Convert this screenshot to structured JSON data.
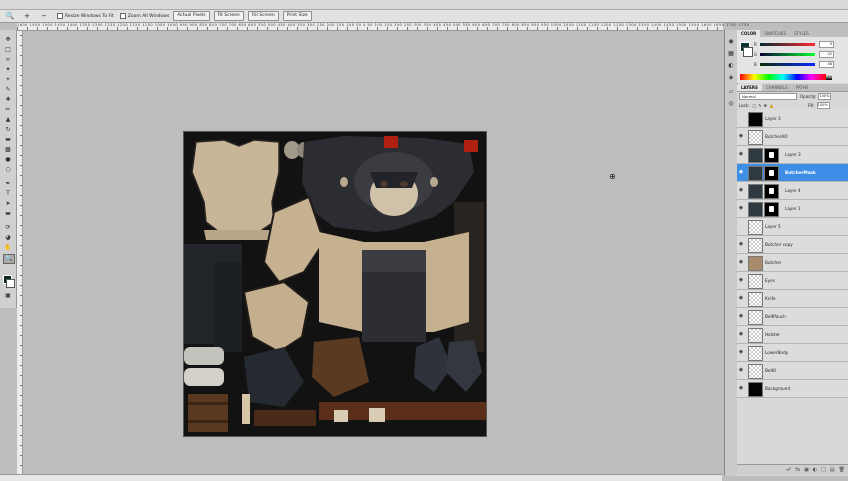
{
  "options_bar": {
    "tool_icon": "zoom-icon",
    "resize_windows": "Resize Windows To Fit",
    "zoom_all_windows": "Zoom All Windows",
    "actual_pixels": "Actual Pixels",
    "fit_screen": "Fit Screen",
    "fill_screen": "Fill Screen",
    "print_size": "Print Size"
  },
  "ruler": {
    "top_labels": "1600 1550 1500 1450 1400 1350 1300 1250 1200 1150 1100 1050 1000 950 900 850 800 750 700 650 600 550 500 450 400 350 300 250 200 150 100 50 0 50 100 150 200 250 300 350 400 450 500 550 600 650 700 750 800 850 900 950 1000 1050 1100 1150 1200 1250 1300 1350 1400 1450 1500 1550 1600 1650 1700 1750"
  },
  "color_panel": {
    "tabs": [
      "COLOR",
      "SWATCHES",
      "STYLES"
    ],
    "active_tab": "COLOR",
    "foreground": "#0d3434",
    "background": "#ffffff",
    "sliders": [
      {
        "label": "R",
        "value": "9"
      },
      {
        "label": "G",
        "value": "42"
      },
      {
        "label": "B",
        "value": "48"
      }
    ]
  },
  "layers_panel": {
    "tabs": [
      "LAYERS",
      "CHANNELS",
      "PATHS"
    ],
    "active_tab": "LAYERS",
    "blend_mode": "Normal",
    "opacity_label": "Opacity:",
    "opacity_value": "100%",
    "lock_label": "Lock:",
    "fill_label": "Fill:",
    "fill_value": "100%",
    "layers": [
      {
        "name": "Layer 3",
        "thumb": "black",
        "mask": false,
        "visible": false,
        "selected": false
      },
      {
        "name": "ButcherAO",
        "thumb": "checker",
        "mask": false,
        "visible": true,
        "selected": false
      },
      {
        "name": "Layer 3",
        "thumb": "tex",
        "mask": true,
        "visible": true,
        "selected": false
      },
      {
        "name": "ButcherMask",
        "thumb": "tex",
        "mask": true,
        "visible": true,
        "selected": true
      },
      {
        "name": "Layer 4",
        "thumb": "tex",
        "mask": true,
        "visible": true,
        "selected": false
      },
      {
        "name": "Layer 1",
        "thumb": "tex",
        "mask": true,
        "visible": true,
        "selected": false
      },
      {
        "name": "Layer 5",
        "thumb": "checker",
        "mask": false,
        "visible": false,
        "selected": false
      },
      {
        "name": "Butcher copy",
        "thumb": "checker",
        "mask": false,
        "visible": true,
        "selected": false
      },
      {
        "name": "Butcher",
        "thumb": "tan",
        "mask": false,
        "visible": true,
        "selected": false
      },
      {
        "name": "Eyes",
        "thumb": "checker",
        "mask": false,
        "visible": true,
        "selected": false
      },
      {
        "name": "Knife",
        "thumb": "checker",
        "mask": false,
        "visible": true,
        "selected": false
      },
      {
        "name": "BeltPouch",
        "thumb": "checker",
        "mask": false,
        "visible": true,
        "selected": false
      },
      {
        "name": "Holster",
        "thumb": "checker",
        "mask": false,
        "visible": true,
        "selected": false
      },
      {
        "name": "LowerBody",
        "thumb": "checker",
        "mask": false,
        "visible": true,
        "selected": false
      },
      {
        "name": "Belt0",
        "thumb": "checker",
        "mask": false,
        "visible": true,
        "selected": false
      },
      {
        "name": "Background",
        "thumb": "black",
        "mask": false,
        "visible": true,
        "selected": false
      }
    ]
  }
}
